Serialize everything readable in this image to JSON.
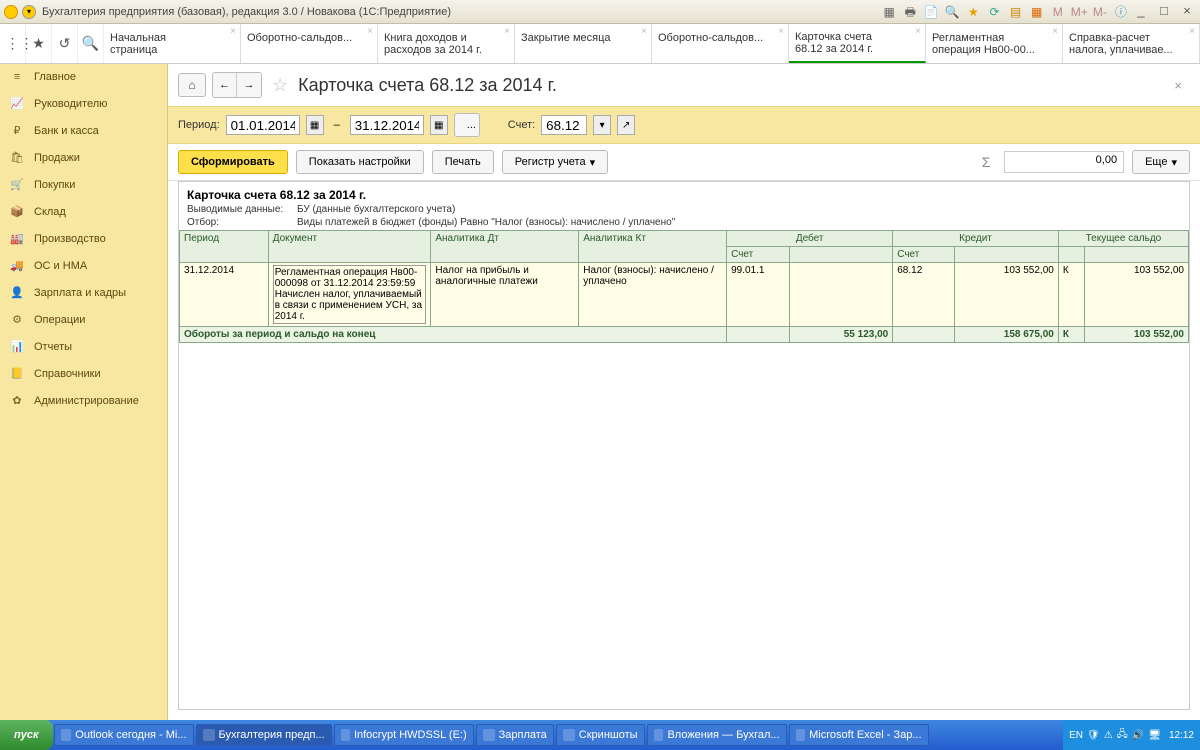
{
  "window": {
    "title": "Бухгалтерия предприятия (базовая), редакция 3.0 / Новакова  (1С:Предприятие)",
    "titlebar_letters": {
      "M": "M",
      "Mplus": "M+",
      "Mminus": "M-"
    }
  },
  "tabs": [
    {
      "l1": "Начальная",
      "l2": "страница"
    },
    {
      "l1": "Оборотно-сальдов...",
      "l2": ""
    },
    {
      "l1": "Книга доходов и",
      "l2": "расходов за 2014 г."
    },
    {
      "l1": "Закрытие месяца",
      "l2": ""
    },
    {
      "l1": "Оборотно-сальдов...",
      "l2": ""
    },
    {
      "l1": "Карточка счета",
      "l2": "68.12 за 2014 г.",
      "active": true
    },
    {
      "l1": "Регламентная",
      "l2": "операция Нв00-00..."
    },
    {
      "l1": "Справка-расчет",
      "l2": "налога, уплачивае..."
    }
  ],
  "sidebar": [
    {
      "icon": "≡",
      "label": "Главное"
    },
    {
      "icon": "📈",
      "label": "Руководителю"
    },
    {
      "icon": "₽",
      "label": "Банк и касса"
    },
    {
      "icon": "🛍",
      "label": "Продажи"
    },
    {
      "icon": "🛒",
      "label": "Покупки"
    },
    {
      "icon": "📦",
      "label": "Склад"
    },
    {
      "icon": "🏭",
      "label": "Производство"
    },
    {
      "icon": "🚚",
      "label": "ОС и НМА"
    },
    {
      "icon": "👤",
      "label": "Зарплата и кадры"
    },
    {
      "icon": "⚙",
      "label": "Операции"
    },
    {
      "icon": "📊",
      "label": "Отчеты"
    },
    {
      "icon": "📒",
      "label": "Справочники"
    },
    {
      "icon": "✿",
      "label": "Администрирование"
    }
  ],
  "page": {
    "title": "Карточка счета 68.12 за 2014 г.",
    "period_label": "Период:",
    "date_from": "01.01.2014",
    "date_to": "31.12.2014",
    "account_label": "Счет:",
    "account": "68.12",
    "btn_generate": "Сформировать",
    "btn_settings": "Показать настройки",
    "btn_print": "Печать",
    "btn_register": "Регистр учета",
    "sum": "0,00",
    "btn_more": "Еще"
  },
  "report": {
    "title": "Карточка счета 68.12 за 2014 г.",
    "out_label": "Выводимые данные:",
    "out_val": "БУ (данные бухгалтерского учета)",
    "filter_label": "Отбор:",
    "filter_val": "Виды платежей в бюджет (фонды) Равно \"Налог (взносы): начислено / уплачено\"",
    "headers": {
      "period": "Период",
      "doc": "Документ",
      "an_dt": "Аналитика Дт",
      "an_kt": "Аналитика Кт",
      "debit": "Дебет",
      "credit": "Кредит",
      "saldo": "Текущее сальдо",
      "acct": "Счет"
    },
    "row": {
      "period": "31.12.2014",
      "doc": "Регламентная операция Нв00-000098 от 31.12.2014 23:59:59 Начислен налог, уплачиваемый в связи с применением УСН, за 2014 г.",
      "an_dt": "Налог на прибыль и аналогичные платежи",
      "an_kt": "Налог (взносы): начислено / уплачено",
      "dt_acct": "99.01.1",
      "dt_sum": "",
      "kt_acct": "68.12",
      "kt_sum": "103 552,00",
      "saldo_dc": "К",
      "saldo": "103 552,00"
    },
    "total": {
      "label": "Обороты за период и сальдо на конец",
      "dt_sum": "55 123,00",
      "kt_sum": "158 675,00",
      "dc": "К",
      "saldo": "103 552,00"
    }
  },
  "taskbar": {
    "start": "пуск",
    "items": [
      "Outlook сегодня - Mi...",
      "Бухгалтерия предп...",
      "Infocrypt HWDSSL (E:)",
      "Зарплата",
      "Скриншоты",
      "Вложения — Бухгал...",
      "Microsoft Excel - Зар..."
    ],
    "lang": "EN",
    "clock": "12:12"
  }
}
